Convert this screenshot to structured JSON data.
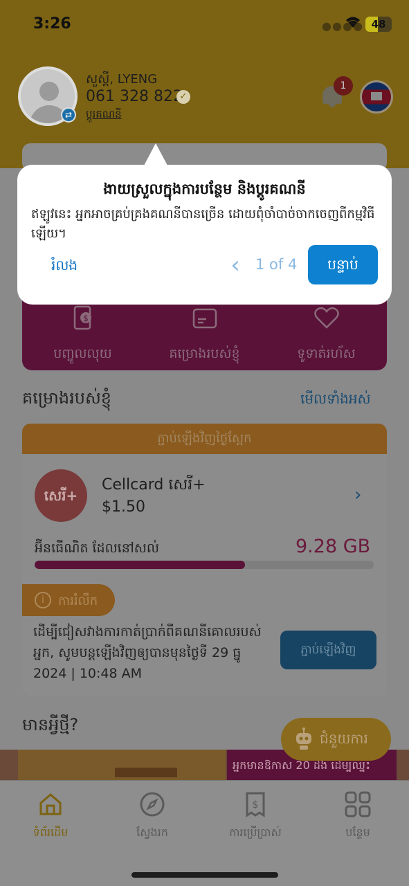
{
  "status_bar": {
    "time": "3:26",
    "battery": "48",
    "battery_level": 0.48
  },
  "header": {
    "greeting": "សួស្តី, LYENG",
    "phone": "061 328 822",
    "switch_account": "ប្តូរគណនី",
    "notification_count": "1"
  },
  "quick_actions": [
    {
      "label": "បញ្ចូលលុយ",
      "icon": "wallet-icon"
    },
    {
      "label": "គម្រោងរបស់ខ្ញុំ",
      "icon": "card-icon"
    },
    {
      "label": "ទូទាត់រហ័ស",
      "icon": "heart-icon"
    }
  ],
  "my_plans": {
    "title": "គម្រោងរបស់ខ្ញុំ",
    "view_all": "មើលទាំងអស់",
    "banner": "ភ្ជាប់ឡើងវិញថ្ងៃស្អែក",
    "logo_text": "សេរី+",
    "plan_name": "Cellcard សេរី+",
    "price": "$1.50",
    "data_label": "អ៊ីនធើណិត ដែលនៅសល់",
    "data_value": "9.28 GB",
    "data_remaining_fraction": 0.62,
    "reminder_label": "ការរំលឹក",
    "reminder_text": "ដើម្បីជៀសវាងការកាត់ប្រាក់ពីគណនីគោលរបស់អ្នក, សូមបន្តឡើងវិញឲ្យបានមុនថ្ងៃទី 29 ធ្នូ 2024 | 10:48 AM",
    "renew_button": "ភ្ជាប់ឡើងវិញ"
  },
  "whats_new": {
    "title": "មានអ្វីថ្មី?",
    "promo_text": "អ្នកមានឱកាស 20 ដង ដើម្បីឈ្នះ"
  },
  "help": {
    "label": "ជំនួយការ"
  },
  "tabbar": [
    {
      "label": "ទំព័រដើម",
      "icon": "home-icon",
      "active": true
    },
    {
      "label": "ស្វែងរក",
      "icon": "compass-icon",
      "active": false
    },
    {
      "label": "ការប្រើប្រាស់",
      "icon": "receipt-icon",
      "active": false
    },
    {
      "label": "បន្ថែម",
      "icon": "grid-icon",
      "active": false
    }
  ],
  "tooltip": {
    "title": "ងាយស្រួលក្នុងការបន្ថែម និងប្តូរគណនី",
    "body": "ឥឡូវនេះ អ្នកអាចគ្រប់គ្រងគណនីបានច្រើន ដោយពុំចាំបាច់ចាកចេញពីកម្មវិធីឡើយ។",
    "skip": "រំលង",
    "step": "1 of 4",
    "next": "បន្ទាប់"
  },
  "colors": {
    "header": "#e6b92a",
    "accent_blue": "#0e82d0",
    "plan_magenta": "#b01f63",
    "banner_orange": "#f0a030"
  }
}
